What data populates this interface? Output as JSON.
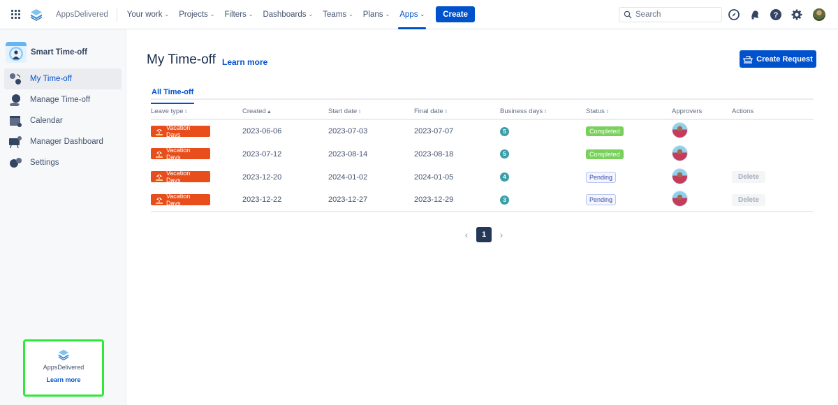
{
  "topnav": {
    "brand": "AppsDelivered",
    "items": [
      {
        "label": "Your work"
      },
      {
        "label": "Projects"
      },
      {
        "label": "Filters"
      },
      {
        "label": "Dashboards"
      },
      {
        "label": "Teams"
      },
      {
        "label": "Plans"
      },
      {
        "label": "Apps",
        "active": true
      }
    ],
    "create_label": "Create",
    "search_placeholder": "Search",
    "icons": [
      "compass-icon",
      "notifications-icon",
      "help-icon",
      "settings-icon",
      "profile-avatar"
    ]
  },
  "sidebar": {
    "app_title": "Smart Time-off",
    "items": [
      {
        "label": "My Time-off",
        "icon": "my-timeoff-icon",
        "active": true
      },
      {
        "label": "Manage Time-off",
        "icon": "manage-timeoff-icon"
      },
      {
        "label": "Calendar",
        "icon": "calendar-icon"
      },
      {
        "label": "Manager Dashboard",
        "icon": "dashboard-icon"
      },
      {
        "label": "Settings",
        "icon": "settings-icon"
      }
    ],
    "promo": {
      "name": "AppsDelivered",
      "link": "Learn more"
    }
  },
  "main": {
    "title": "My Time-off",
    "learn_more": "Learn more",
    "create_request": "Create Request",
    "tabs": [
      {
        "label": "All Time-off",
        "active": true
      }
    ],
    "table": {
      "columns": [
        {
          "label": "Leave type",
          "sortable": true
        },
        {
          "label": "Created",
          "sortable": true,
          "sorted": "asc"
        },
        {
          "label": "Start date",
          "sortable": true
        },
        {
          "label": "Final date",
          "sortable": true
        },
        {
          "label": "Business days",
          "sortable": true
        },
        {
          "label": "Status",
          "sortable": true
        },
        {
          "label": "Approvers",
          "sortable": false
        },
        {
          "label": "Actions",
          "sortable": false
        }
      ],
      "rows": [
        {
          "leave_type": "Vacation Days",
          "created": "2023-06-06",
          "start": "2023-07-03",
          "final": "2023-07-07",
          "days": "5",
          "status": "Completed",
          "action": ""
        },
        {
          "leave_type": "Vacation Days",
          "created": "2023-07-12",
          "start": "2023-08-14",
          "final": "2023-08-18",
          "days": "5",
          "status": "Completed",
          "action": ""
        },
        {
          "leave_type": "Vacation Days",
          "created": "2023-12-20",
          "start": "2024-01-02",
          "final": "2024-01-05",
          "days": "4",
          "status": "Pending",
          "action": "Delete"
        },
        {
          "leave_type": "Vacation Days",
          "created": "2023-12-22",
          "start": "2023-12-27",
          "final": "2023-12-29",
          "days": "3",
          "status": "Pending",
          "action": "Delete"
        }
      ]
    },
    "pagination": {
      "current": "1",
      "prev": "‹",
      "next": "›"
    }
  },
  "colors": {
    "primary": "#0052cc",
    "leave_badge": "#e84e1b",
    "completed": "#79d05b",
    "pending_bg": "#f4f5ff",
    "days_badge": "#3c9ea8",
    "promo_border": "#2ee83a"
  }
}
